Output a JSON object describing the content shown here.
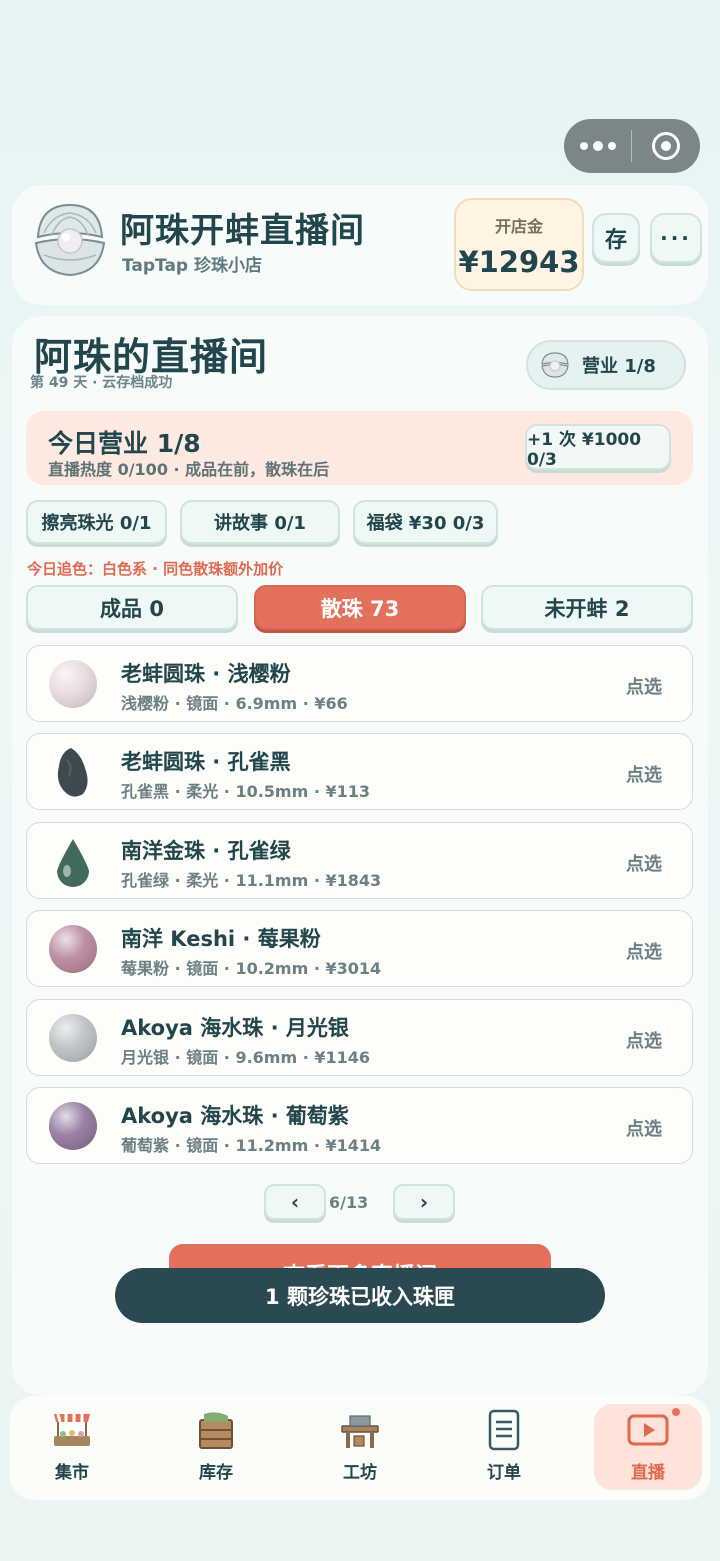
{
  "header": {
    "title": "阿珠开蚌直播间",
    "subtitle": "TapTap 珍珠小店",
    "gold_label": "开店金",
    "gold_value": "¥12943",
    "save_label": "存",
    "more_label": "···"
  },
  "room": {
    "title": "阿珠的直播间",
    "subtitle": "第 49 天 · 云存档成功",
    "business_pill": "营业 1/8"
  },
  "today": {
    "title": "今日营业 1/8",
    "subtitle": "直播热度 0/100 · 成品在前，散珠在后",
    "plus_button": "+1 次 ¥1000 0/3"
  },
  "actions": [
    {
      "label": "擦亮珠光 0/1"
    },
    {
      "label": "讲故事 0/1"
    },
    {
      "label": "福袋 ¥30 0/3"
    }
  ],
  "chase_color": "今日追色：白色系 · 同色散珠额外加价",
  "tabs": [
    {
      "label": "成品 0",
      "active": false
    },
    {
      "label": "散珠 73",
      "active": true
    },
    {
      "label": "未开蚌 2",
      "active": false
    }
  ],
  "items": [
    {
      "name": "老蚌圆珠 · 浅樱粉",
      "meta": "浅樱粉 · 镜面 · 6.9mm · ¥66",
      "pick": "点选",
      "color": "#e8d8dc",
      "shape": "round"
    },
    {
      "name": "老蚌圆珠 · 孔雀黑",
      "meta": "孔雀黑 · 柔光 · 10.5mm · ¥113",
      "pick": "点选",
      "color": "#3d4a52",
      "shape": "baroque"
    },
    {
      "name": "南洋金珠 · 孔雀绿",
      "meta": "孔雀绿 · 柔光 · 11.1mm · ¥1843",
      "pick": "点选",
      "color": "#3f6a5c",
      "shape": "drop"
    },
    {
      "name": "南洋 Keshi · 莓果粉",
      "meta": "莓果粉 · 镜面 · 10.2mm · ¥3014",
      "pick": "点选",
      "color": "#b8849a",
      "shape": "round"
    },
    {
      "name": "Akoya 海水珠 · 月光银",
      "meta": "月光银 · 镜面 · 9.6mm · ¥1146",
      "pick": "点选",
      "color": "#b9c0c2",
      "shape": "round"
    },
    {
      "name": "Akoya 海水珠 · 葡萄紫",
      "meta": "葡萄紫 · 镜面 · 11.2mm · ¥1414",
      "pick": "点选",
      "color": "#8e7498",
      "shape": "round"
    }
  ],
  "pager": {
    "prev": "‹",
    "text": "6/13",
    "next": "›"
  },
  "primary_button": "查看更多直播间",
  "toast": "1 颗珍珠已收入珠匣",
  "nav": [
    {
      "label": "集市",
      "icon": "market-stall-icon",
      "active": false
    },
    {
      "label": "库存",
      "icon": "crate-icon",
      "active": false
    },
    {
      "label": "工坊",
      "icon": "workbench-icon",
      "active": false
    },
    {
      "label": "订单",
      "icon": "document-icon",
      "active": false
    },
    {
      "label": "直播",
      "icon": "play-screen-icon",
      "active": true
    }
  ],
  "colors": {
    "accent": "#e2705c",
    "primary_text": "#22464d",
    "toast_bg": "#2a4951"
  }
}
